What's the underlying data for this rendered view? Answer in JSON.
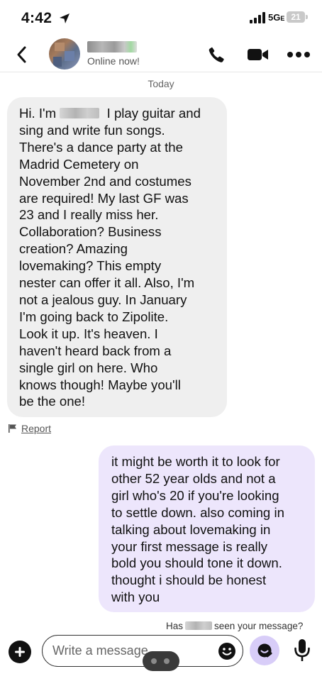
{
  "status_bar": {
    "time": "4:42",
    "network": "5G",
    "network_suffix": "E",
    "battery": "21"
  },
  "header": {
    "status": "Online now!"
  },
  "chat": {
    "date_separator": "Today",
    "incoming": {
      "lines": [
        "Hi.  I'm",
        "I play guitar and",
        "sing and write fun songs.",
        "There's a dance party at the",
        "Madrid Cemetery on",
        "November 2nd and costumes",
        "are required!  My last GF was",
        "23 and I really miss her.",
        "Collaboration?  Business",
        "creation?  Amazing",
        "lovemaking?  This empty",
        "nester can offer it all.  Also, I'm",
        "not a jealous guy.  In January",
        "I'm going back to Zipolite.",
        "Look it up.  It's heaven.  I",
        "haven't heard back from a",
        "single girl on here.  Who",
        "knows though!  Maybe you'll",
        "be the one!"
      ]
    },
    "report_label": "Report",
    "outgoing": {
      "lines": [
        "it might be worth it to look for",
        "other 52 year olds and not a",
        "girl who's 20 if you're looking",
        "to settle down. also coming in",
        "talking about lovemaking in",
        "your first message is really",
        "bold you should tone it down.",
        "thought i should be honest",
        "with you"
      ]
    },
    "seen_prefix": "Has",
    "seen_suffix": "seen your message?"
  },
  "composer": {
    "placeholder": "Write a message"
  },
  "icons": {
    "back": "chevron-left-icon",
    "phone": "phone-icon",
    "video": "video-camera-icon",
    "more": "more-horizontal-icon",
    "report": "flag-icon",
    "add": "plus-icon",
    "emoji": "emoji-icon",
    "gif": "gif-sticker-icon",
    "mic": "microphone-icon"
  },
  "colors": {
    "incoming_bubble": "#efefef",
    "outgoing_bubble": "#ede6fc",
    "accent": "#d8cdf8"
  }
}
